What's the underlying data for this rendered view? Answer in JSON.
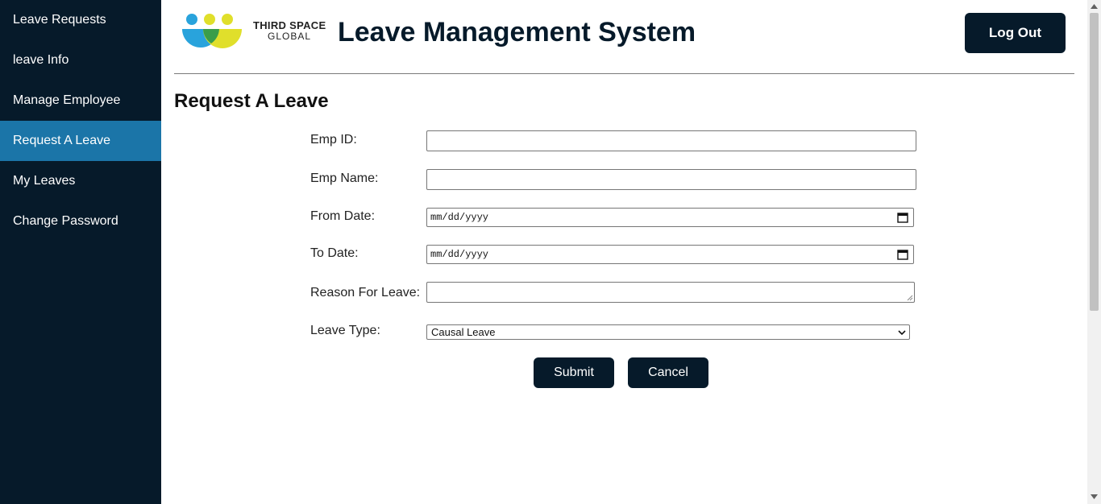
{
  "sidebar": {
    "items": [
      {
        "label": "Leave Requests"
      },
      {
        "label": "leave Info"
      },
      {
        "label": "Manage Employee"
      },
      {
        "label": "Request A Leave",
        "active": true
      },
      {
        "label": "My Leaves"
      },
      {
        "label": "Change Password"
      }
    ]
  },
  "header": {
    "logo": {
      "line1": "THIRD SPACE",
      "line2": "GLOBAL"
    },
    "title": "Leave Management System",
    "logout_label": "Log Out"
  },
  "form": {
    "title": "Request A Leave",
    "emp_id": {
      "label": "Emp ID:",
      "value": ""
    },
    "emp_name": {
      "label": "Emp Name:",
      "value": ""
    },
    "from_date": {
      "label": "From Date:",
      "placeholder": "mm/dd/yyyy"
    },
    "to_date": {
      "label": "To Date:",
      "placeholder": "mm/dd/yyyy"
    },
    "reason": {
      "label": "Reason For Leave:",
      "value": ""
    },
    "leave_type": {
      "label": "Leave Type:",
      "selected": "Causal Leave"
    },
    "submit_label": "Submit",
    "cancel_label": "Cancel"
  },
  "colors": {
    "sidebar_bg": "#061a2a",
    "active_item": "#1b75a8",
    "button": "#061a2a"
  }
}
